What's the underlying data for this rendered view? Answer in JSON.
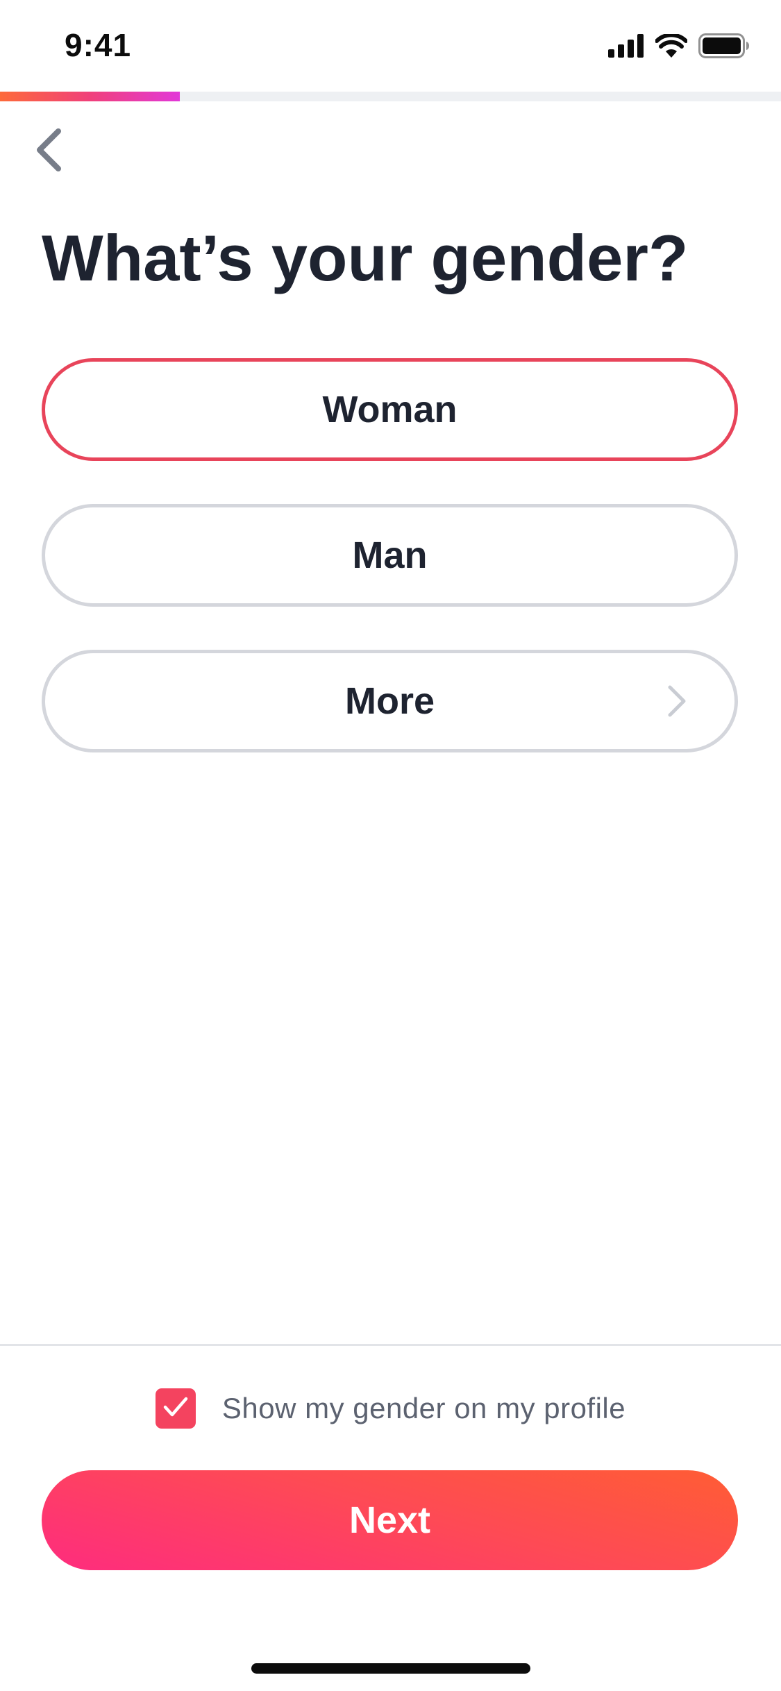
{
  "status_bar": {
    "time": "9:41",
    "icons": [
      "cellular-signal-icon",
      "wifi-icon",
      "battery-icon"
    ]
  },
  "progress": {
    "fraction": 0.23,
    "gradient_colors": [
      "#fd6a3a",
      "#f0407a",
      "#e238d8"
    ]
  },
  "nav": {
    "back_icon": "chevron-left-icon"
  },
  "page": {
    "title": "What’s your gender?"
  },
  "options": [
    {
      "label": "Woman",
      "selected": true
    },
    {
      "label": "Man",
      "selected": false
    },
    {
      "label": "More",
      "selected": false,
      "icon": "chevron-right-icon"
    }
  ],
  "show_gender": {
    "checked": true,
    "label": "Show my gender on my profile"
  },
  "next_button": {
    "label": "Next"
  },
  "colors": {
    "accent": "#f4435f",
    "selected_border": "#e8445a",
    "unselected_border": "#d4d6dc",
    "title_text": "#1e2330",
    "next_gradient": [
      "#fe2c7e",
      "#fe4a55",
      "#ff5d34"
    ]
  }
}
